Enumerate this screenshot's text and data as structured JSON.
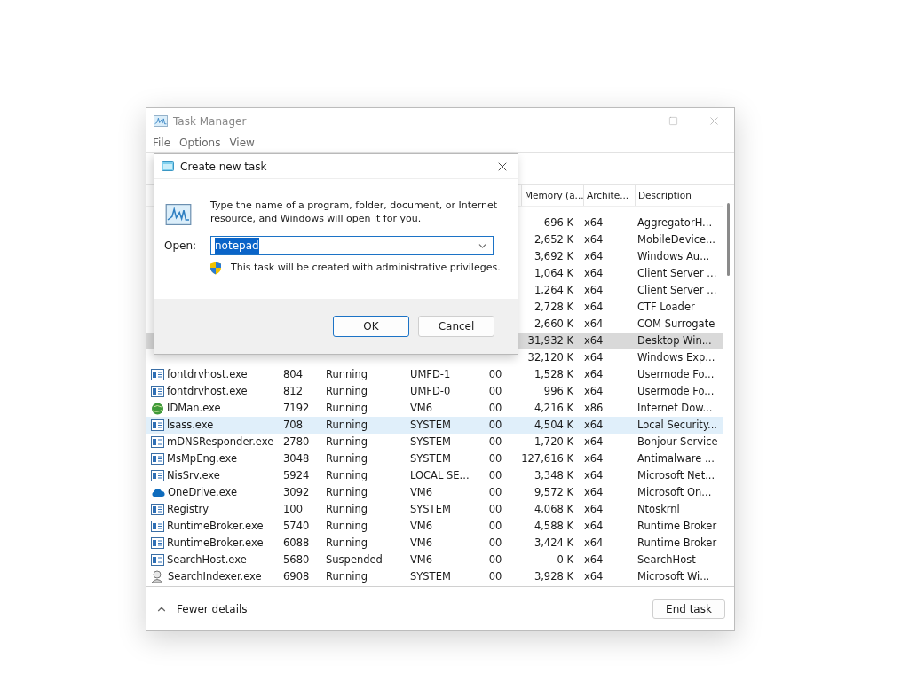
{
  "window": {
    "title": "Task Manager"
  },
  "menu": [
    "File",
    "Options",
    "View"
  ],
  "table": {
    "columns": [
      {
        "label": "Memory (a..."
      },
      {
        "label": "Archite..."
      },
      {
        "label": "Description"
      }
    ],
    "rows": [
      {
        "memory": "696 K",
        "arch": "x64",
        "description": "AggregatorH...",
        "selected": false,
        "hovered": false
      },
      {
        "memory": "2,652 K",
        "arch": "x64",
        "description": "MobileDevice...",
        "selected": false,
        "hovered": false
      },
      {
        "memory": "3,692 K",
        "arch": "x64",
        "description": "Windows Au...",
        "selected": false,
        "hovered": false
      },
      {
        "memory": "1,064 K",
        "arch": "x64",
        "description": "Client Server ...",
        "selected": false,
        "hovered": false
      },
      {
        "memory": "1,264 K",
        "arch": "x64",
        "description": "Client Server ...",
        "selected": false,
        "hovered": false
      },
      {
        "memory": "2,728 K",
        "arch": "x64",
        "description": "CTF Loader",
        "selected": false,
        "hovered": false
      },
      {
        "memory": "2,660 K",
        "arch": "x64",
        "description": "COM Surrogate",
        "selected": false,
        "hovered": false
      },
      {
        "memory": "31,932 K",
        "arch": "x64",
        "description": "Desktop Win...",
        "selected": true,
        "hovered": false
      },
      {
        "memory": "32,120 K",
        "arch": "x64",
        "description": "Windows Exp...",
        "selected": false,
        "hovered": false
      },
      {
        "kind": "app",
        "name": "fontdrvhost.exe",
        "pid": "804",
        "status": "Running",
        "user": "UMFD-1",
        "cpu": "00",
        "memory": "1,528 K",
        "arch": "x64",
        "description": "Usermode Fo...",
        "selected": false,
        "hovered": false
      },
      {
        "kind": "app",
        "name": "fontdrvhost.exe",
        "pid": "812",
        "status": "Running",
        "user": "UMFD-0",
        "cpu": "00",
        "memory": "996 K",
        "arch": "x64",
        "description": "Usermode Fo...",
        "selected": false,
        "hovered": false
      },
      {
        "kind": "globe",
        "name": "IDMan.exe",
        "pid": "7192",
        "status": "Running",
        "user": "VM6",
        "cpu": "00",
        "memory": "4,216 K",
        "arch": "x86",
        "description": "Internet Dow...",
        "selected": false,
        "hovered": false
      },
      {
        "kind": "app",
        "name": "lsass.exe",
        "pid": "708",
        "status": "Running",
        "user": "SYSTEM",
        "cpu": "00",
        "memory": "4,504 K",
        "arch": "x64",
        "description": "Local Security...",
        "selected": false,
        "hovered": true
      },
      {
        "kind": "app",
        "name": "mDNSResponder.exe",
        "pid": "2780",
        "status": "Running",
        "user": "SYSTEM",
        "cpu": "00",
        "memory": "1,720 K",
        "arch": "x64",
        "description": "Bonjour Service",
        "selected": false,
        "hovered": false
      },
      {
        "kind": "app",
        "name": "MsMpEng.exe",
        "pid": "3048",
        "status": "Running",
        "user": "SYSTEM",
        "cpu": "00",
        "memory": "127,616 K",
        "arch": "x64",
        "description": "Antimalware ...",
        "selected": false,
        "hovered": false
      },
      {
        "kind": "app",
        "name": "NisSrv.exe",
        "pid": "5924",
        "status": "Running",
        "user": "LOCAL SE...",
        "cpu": "00",
        "memory": "3,348 K",
        "arch": "x64",
        "description": "Microsoft Net...",
        "selected": false,
        "hovered": false
      },
      {
        "kind": "cloud",
        "name": "OneDrive.exe",
        "pid": "3092",
        "status": "Running",
        "user": "VM6",
        "cpu": "00",
        "memory": "9,572 K",
        "arch": "x64",
        "description": "Microsoft On...",
        "selected": false,
        "hovered": false
      },
      {
        "kind": "app",
        "name": "Registry",
        "pid": "100",
        "status": "Running",
        "user": "SYSTEM",
        "cpu": "00",
        "memory": "4,068 K",
        "arch": "x64",
        "description": "Ntoskrnl",
        "selected": false,
        "hovered": false
      },
      {
        "kind": "app",
        "name": "RuntimeBroker.exe",
        "pid": "5740",
        "status": "Running",
        "user": "VM6",
        "cpu": "00",
        "memory": "4,588 K",
        "arch": "x64",
        "description": "Runtime Broker",
        "selected": false,
        "hovered": false
      },
      {
        "kind": "app",
        "name": "RuntimeBroker.exe",
        "pid": "6088",
        "status": "Running",
        "user": "VM6",
        "cpu": "00",
        "memory": "3,424 K",
        "arch": "x64",
        "description": "Runtime Broker",
        "selected": false,
        "hovered": false
      },
      {
        "kind": "app",
        "name": "SearchHost.exe",
        "pid": "5680",
        "status": "Suspended",
        "user": "VM6",
        "cpu": "00",
        "memory": "0 K",
        "arch": "x64",
        "description": "SearchHost",
        "selected": false,
        "hovered": false
      },
      {
        "kind": "person",
        "name": "SearchIndexer.exe",
        "pid": "6908",
        "status": "Running",
        "user": "SYSTEM",
        "cpu": "00",
        "memory": "3,928 K",
        "arch": "x64",
        "description": "Microsoft Wi...",
        "selected": false,
        "hovered": false
      }
    ]
  },
  "footer": {
    "toggle": "Fewer details",
    "button": "End task"
  },
  "dialog": {
    "title": "Create new task",
    "message": "Type the name of a program, folder, document, or Internet resource, and Windows will open it for you.",
    "open_label": "Open:",
    "value": "notepad",
    "text_selected": true,
    "note": "This task will be created with administrative privileges.",
    "ok": "OK",
    "cancel": "Cancel"
  }
}
